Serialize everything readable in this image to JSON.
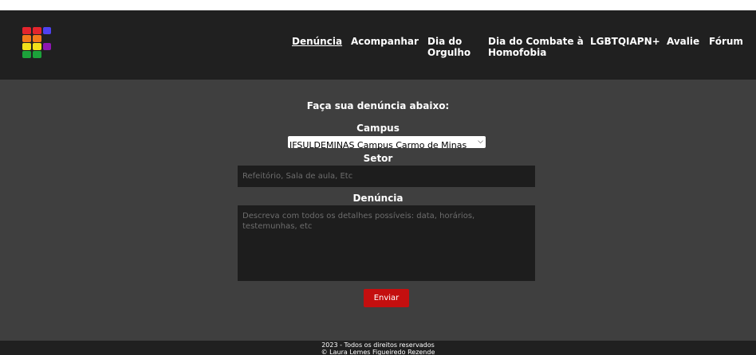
{
  "header": {
    "logo_name": "rainbow-grid-logo",
    "nav": [
      {
        "label": "Denúncia",
        "active": true
      },
      {
        "label": "Acompanhar",
        "active": false
      },
      {
        "label_line1": "Dia do",
        "label_line2": "Orgulho",
        "active": false
      },
      {
        "label_line1": "Dia do Combate à",
        "label_line2": "Homofobia",
        "active": false
      },
      {
        "label": "LGBTQIAPN+",
        "active": false
      },
      {
        "label": "Avalie",
        "active": false
      },
      {
        "label": "Fórum",
        "active": false
      }
    ]
  },
  "form": {
    "title": "Faça sua denúncia abaixo:",
    "campus_label": "Campus",
    "campus_selected": "IFSULDEMINAS Campus Carmo de Minas",
    "sector_label": "Setor",
    "sector_placeholder": "Refeitório, Sala de aula, Etc",
    "report_label": "Denúncia",
    "report_placeholder": "Descreva com todos os detalhes possíveis: data, horários, testemunhas, etc",
    "submit_label": "Enviar"
  },
  "footer": {
    "line1": "2023 - Todos os direitos reservados",
    "line2": "© Laura Lemes Figueiredo Rezende"
  },
  "colors": {
    "header_bg": "#202020",
    "main_bg": "#3f3f3f",
    "field_bg": "#1d1d1d",
    "button_bg": "#c40f0f",
    "logo": [
      "#e4252d",
      "#e4252d",
      "#4f41f0",
      "#f47a1b",
      "#f47a1b",
      "#f2e11a",
      "#f2e11a",
      "#8e17b3",
      "#1ca23a",
      "#1ca23a"
    ]
  }
}
